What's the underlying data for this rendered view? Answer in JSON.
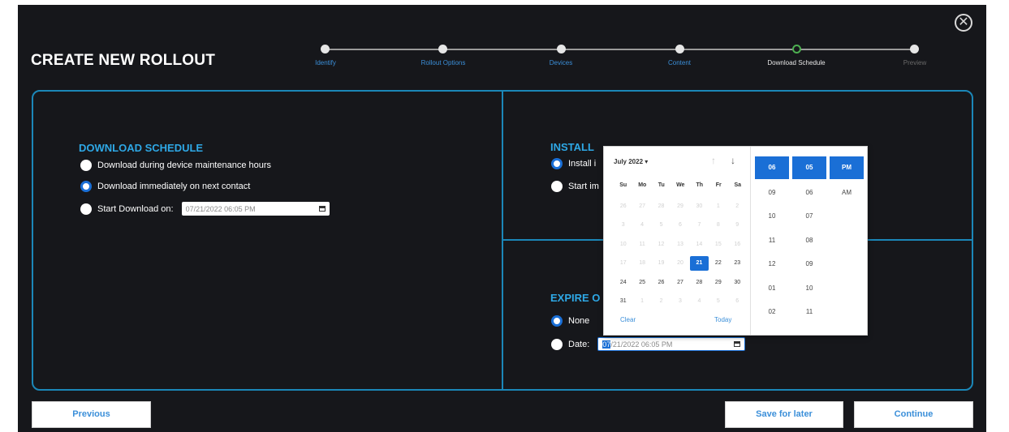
{
  "header": {
    "title": "CREATE NEW ROLLOUT"
  },
  "stepper": {
    "steps": [
      "Identify",
      "Rollout Options",
      "Devices",
      "Content",
      "Download Schedule",
      "Preview"
    ]
  },
  "download_schedule": {
    "title": "DOWNLOAD SCHEDULE",
    "options": [
      "Download during device maintenance hours",
      "Download immediately on next contact",
      "Start Download on:"
    ],
    "selected_index": 1,
    "start_date_value": "07/21/2022 06:05 PM"
  },
  "install_schedule": {
    "title": "INSTALL SCHEDULE OPTIONS",
    "title_visible": "INSTALL",
    "options_visible": [
      "Install i",
      "Start im"
    ],
    "selected_index": 0
  },
  "expire": {
    "title_visible": "EXPIRE O",
    "options": [
      "None",
      "Date:"
    ],
    "selected_index": 0,
    "date_value": "07/21/2022 06:05 PM",
    "date_prefix": "07",
    "date_rest": "/21/2022 06:05 PM"
  },
  "calendar": {
    "month_label": "July 2022 ▾",
    "weekdays": [
      "Su",
      "Mo",
      "Tu",
      "We",
      "Th",
      "Fr",
      "Sa"
    ],
    "weeks": [
      [
        "26",
        "27",
        "28",
        "29",
        "30",
        "1",
        "2"
      ],
      [
        "3",
        "4",
        "5",
        "6",
        "7",
        "8",
        "9"
      ],
      [
        "10",
        "11",
        "12",
        "13",
        "14",
        "15",
        "16"
      ],
      [
        "17",
        "18",
        "19",
        "20",
        "21",
        "22",
        "23"
      ],
      [
        "24",
        "25",
        "26",
        "27",
        "28",
        "29",
        "30"
      ],
      [
        "31",
        "1",
        "2",
        "3",
        "4",
        "5",
        "6"
      ]
    ],
    "clear_label": "Clear",
    "today_label": "Today",
    "selected_day": "21"
  },
  "time_picker": {
    "hours": [
      "06",
      "09",
      "10",
      "11",
      "12",
      "01",
      "02"
    ],
    "minutes": [
      "05",
      "06",
      "07",
      "08",
      "09",
      "10",
      "11"
    ],
    "period": [
      "PM",
      "AM"
    ]
  },
  "buttons": {
    "previous": "Previous",
    "save_for_later": "Save for later",
    "continue": "Continue"
  },
  "icons": {
    "close": "close-circle-icon",
    "calendar": "calendar-icon"
  },
  "colors": {
    "accent": "#1b87b8",
    "selected": "#1a6fd6",
    "link": "#3b8fd9",
    "background": "#16171b"
  }
}
